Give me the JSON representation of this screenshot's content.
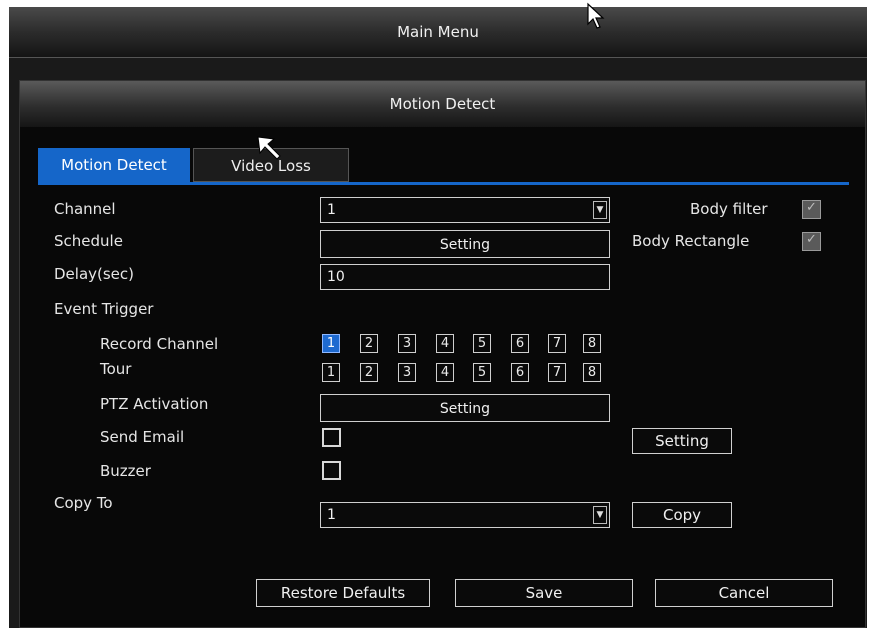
{
  "main_menu": {
    "title": "Main Menu"
  },
  "dialog": {
    "title": "Motion Detect"
  },
  "tabs": [
    {
      "label": "Motion Detect",
      "active": true
    },
    {
      "label": "Video Loss",
      "active": false
    }
  ],
  "form": {
    "channel": {
      "label": "Channel",
      "value": "1"
    },
    "schedule": {
      "label": "Schedule",
      "button": "Setting"
    },
    "delay": {
      "label": "Delay(sec)",
      "value": "10"
    },
    "event_trigger": {
      "label": "Event Trigger"
    },
    "record_channel": {
      "label": "Record Channel",
      "channels": [
        "1",
        "2",
        "3",
        "4",
        "5",
        "6",
        "7",
        "8"
      ],
      "selected": [
        "1"
      ]
    },
    "tour": {
      "label": "Tour",
      "channels": [
        "1",
        "2",
        "3",
        "4",
        "5",
        "6",
        "7",
        "8"
      ],
      "selected": []
    },
    "ptz": {
      "label": "PTZ Activation",
      "button": "Setting"
    },
    "send_email": {
      "label": "Send Email",
      "checked": false,
      "button": "Setting"
    },
    "buzzer": {
      "label": "Buzzer",
      "checked": false
    },
    "copy_to": {
      "label": "Copy To",
      "value": "1",
      "button": "Copy"
    },
    "body_filter": {
      "label": "Body filter",
      "checked": true
    },
    "body_rectangle": {
      "label": "Body Rectangle",
      "checked": true
    }
  },
  "footer": {
    "restore": "Restore Defaults",
    "save": "Save",
    "cancel": "Cancel"
  },
  "icons": {
    "dropdown": "chevron-down-icon",
    "check": "check-icon",
    "pointer": "mouse-pointer-icon"
  },
  "colors": {
    "accent": "#1566c9",
    "background": "#080808",
    "text": "#e8e8e8"
  }
}
